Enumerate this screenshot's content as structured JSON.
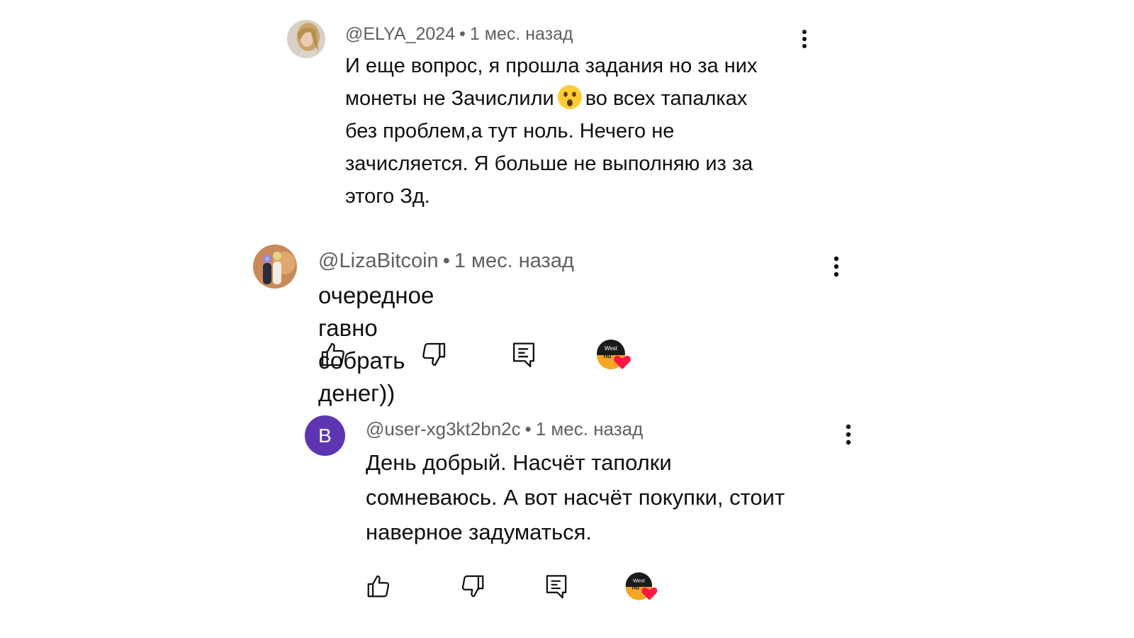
{
  "comments": [
    {
      "author": "@ELYA_2024",
      "time": "1 мес. назад",
      "text_lines": [
        "И еще вопрос, я прошла задания но за них",
        "монеты не Зачислили",
        "во всех тапалках",
        "без проблем,а тут ноль. Нечего не",
        "зачисляется. Я больше не выполняю из за",
        "этого Зд."
      ],
      "emoji": "astonished-face"
    },
    {
      "author": "@LizaBitcoin",
      "time": "1 мес. назад",
      "text": "очередное гавно собрать денег))"
    },
    {
      "author": "@user-xg3kt2bn2c",
      "time": "1 мес. назад",
      "avatar_letter": "B",
      "text_lines": [
        "День добрый. Насчёт таполки",
        "сомневаюсь. А вот насчёт покупки, стоит",
        "наверное задуматься."
      ]
    }
  ],
  "separator": "•",
  "creator_badge": {
    "text_top": "West",
    "text_bottom": "hu"
  },
  "colors": {
    "meta": "#606060",
    "text": "#0f0f0f",
    "letter_avatar": "#5e35b1",
    "heart": "#ff1744",
    "badge_orange": "#f5a623"
  }
}
